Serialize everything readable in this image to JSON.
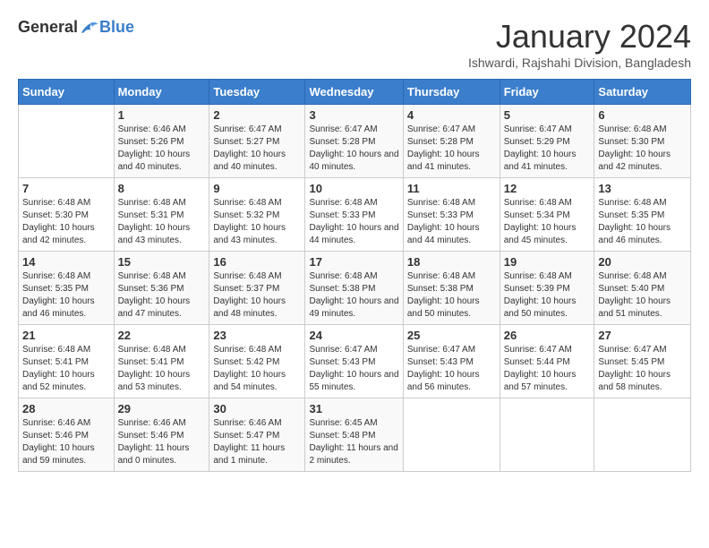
{
  "header": {
    "logo_general": "General",
    "logo_blue": "Blue",
    "month_year": "January 2024",
    "location": "Ishwardi, Rajshahi Division, Bangladesh"
  },
  "weekdays": [
    "Sunday",
    "Monday",
    "Tuesday",
    "Wednesday",
    "Thursday",
    "Friday",
    "Saturday"
  ],
  "weeks": [
    [
      {
        "day": "",
        "sunrise": "",
        "sunset": "",
        "daylight": ""
      },
      {
        "day": "1",
        "sunrise": "Sunrise: 6:46 AM",
        "sunset": "Sunset: 5:26 PM",
        "daylight": "Daylight: 10 hours and 40 minutes."
      },
      {
        "day": "2",
        "sunrise": "Sunrise: 6:47 AM",
        "sunset": "Sunset: 5:27 PM",
        "daylight": "Daylight: 10 hours and 40 minutes."
      },
      {
        "day": "3",
        "sunrise": "Sunrise: 6:47 AM",
        "sunset": "Sunset: 5:28 PM",
        "daylight": "Daylight: 10 hours and 40 minutes."
      },
      {
        "day": "4",
        "sunrise": "Sunrise: 6:47 AM",
        "sunset": "Sunset: 5:28 PM",
        "daylight": "Daylight: 10 hours and 41 minutes."
      },
      {
        "day": "5",
        "sunrise": "Sunrise: 6:47 AM",
        "sunset": "Sunset: 5:29 PM",
        "daylight": "Daylight: 10 hours and 41 minutes."
      },
      {
        "day": "6",
        "sunrise": "Sunrise: 6:48 AM",
        "sunset": "Sunset: 5:30 PM",
        "daylight": "Daylight: 10 hours and 42 minutes."
      }
    ],
    [
      {
        "day": "7",
        "sunrise": "Sunrise: 6:48 AM",
        "sunset": "Sunset: 5:30 PM",
        "daylight": "Daylight: 10 hours and 42 minutes."
      },
      {
        "day": "8",
        "sunrise": "Sunrise: 6:48 AM",
        "sunset": "Sunset: 5:31 PM",
        "daylight": "Daylight: 10 hours and 43 minutes."
      },
      {
        "day": "9",
        "sunrise": "Sunrise: 6:48 AM",
        "sunset": "Sunset: 5:32 PM",
        "daylight": "Daylight: 10 hours and 43 minutes."
      },
      {
        "day": "10",
        "sunrise": "Sunrise: 6:48 AM",
        "sunset": "Sunset: 5:33 PM",
        "daylight": "Daylight: 10 hours and 44 minutes."
      },
      {
        "day": "11",
        "sunrise": "Sunrise: 6:48 AM",
        "sunset": "Sunset: 5:33 PM",
        "daylight": "Daylight: 10 hours and 44 minutes."
      },
      {
        "day": "12",
        "sunrise": "Sunrise: 6:48 AM",
        "sunset": "Sunset: 5:34 PM",
        "daylight": "Daylight: 10 hours and 45 minutes."
      },
      {
        "day": "13",
        "sunrise": "Sunrise: 6:48 AM",
        "sunset": "Sunset: 5:35 PM",
        "daylight": "Daylight: 10 hours and 46 minutes."
      }
    ],
    [
      {
        "day": "14",
        "sunrise": "Sunrise: 6:48 AM",
        "sunset": "Sunset: 5:35 PM",
        "daylight": "Daylight: 10 hours and 46 minutes."
      },
      {
        "day": "15",
        "sunrise": "Sunrise: 6:48 AM",
        "sunset": "Sunset: 5:36 PM",
        "daylight": "Daylight: 10 hours and 47 minutes."
      },
      {
        "day": "16",
        "sunrise": "Sunrise: 6:48 AM",
        "sunset": "Sunset: 5:37 PM",
        "daylight": "Daylight: 10 hours and 48 minutes."
      },
      {
        "day": "17",
        "sunrise": "Sunrise: 6:48 AM",
        "sunset": "Sunset: 5:38 PM",
        "daylight": "Daylight: 10 hours and 49 minutes."
      },
      {
        "day": "18",
        "sunrise": "Sunrise: 6:48 AM",
        "sunset": "Sunset: 5:38 PM",
        "daylight": "Daylight: 10 hours and 50 minutes."
      },
      {
        "day": "19",
        "sunrise": "Sunrise: 6:48 AM",
        "sunset": "Sunset: 5:39 PM",
        "daylight": "Daylight: 10 hours and 50 minutes."
      },
      {
        "day": "20",
        "sunrise": "Sunrise: 6:48 AM",
        "sunset": "Sunset: 5:40 PM",
        "daylight": "Daylight: 10 hours and 51 minutes."
      }
    ],
    [
      {
        "day": "21",
        "sunrise": "Sunrise: 6:48 AM",
        "sunset": "Sunset: 5:41 PM",
        "daylight": "Daylight: 10 hours and 52 minutes."
      },
      {
        "day": "22",
        "sunrise": "Sunrise: 6:48 AM",
        "sunset": "Sunset: 5:41 PM",
        "daylight": "Daylight: 10 hours and 53 minutes."
      },
      {
        "day": "23",
        "sunrise": "Sunrise: 6:48 AM",
        "sunset": "Sunset: 5:42 PM",
        "daylight": "Daylight: 10 hours and 54 minutes."
      },
      {
        "day": "24",
        "sunrise": "Sunrise: 6:47 AM",
        "sunset": "Sunset: 5:43 PM",
        "daylight": "Daylight: 10 hours and 55 minutes."
      },
      {
        "day": "25",
        "sunrise": "Sunrise: 6:47 AM",
        "sunset": "Sunset: 5:43 PM",
        "daylight": "Daylight: 10 hours and 56 minutes."
      },
      {
        "day": "26",
        "sunrise": "Sunrise: 6:47 AM",
        "sunset": "Sunset: 5:44 PM",
        "daylight": "Daylight: 10 hours and 57 minutes."
      },
      {
        "day": "27",
        "sunrise": "Sunrise: 6:47 AM",
        "sunset": "Sunset: 5:45 PM",
        "daylight": "Daylight: 10 hours and 58 minutes."
      }
    ],
    [
      {
        "day": "28",
        "sunrise": "Sunrise: 6:46 AM",
        "sunset": "Sunset: 5:46 PM",
        "daylight": "Daylight: 10 hours and 59 minutes."
      },
      {
        "day": "29",
        "sunrise": "Sunrise: 6:46 AM",
        "sunset": "Sunset: 5:46 PM",
        "daylight": "Daylight: 11 hours and 0 minutes."
      },
      {
        "day": "30",
        "sunrise": "Sunrise: 6:46 AM",
        "sunset": "Sunset: 5:47 PM",
        "daylight": "Daylight: 11 hours and 1 minute."
      },
      {
        "day": "31",
        "sunrise": "Sunrise: 6:45 AM",
        "sunset": "Sunset: 5:48 PM",
        "daylight": "Daylight: 11 hours and 2 minutes."
      },
      {
        "day": "",
        "sunrise": "",
        "sunset": "",
        "daylight": ""
      },
      {
        "day": "",
        "sunrise": "",
        "sunset": "",
        "daylight": ""
      },
      {
        "day": "",
        "sunrise": "",
        "sunset": "",
        "daylight": ""
      }
    ]
  ]
}
